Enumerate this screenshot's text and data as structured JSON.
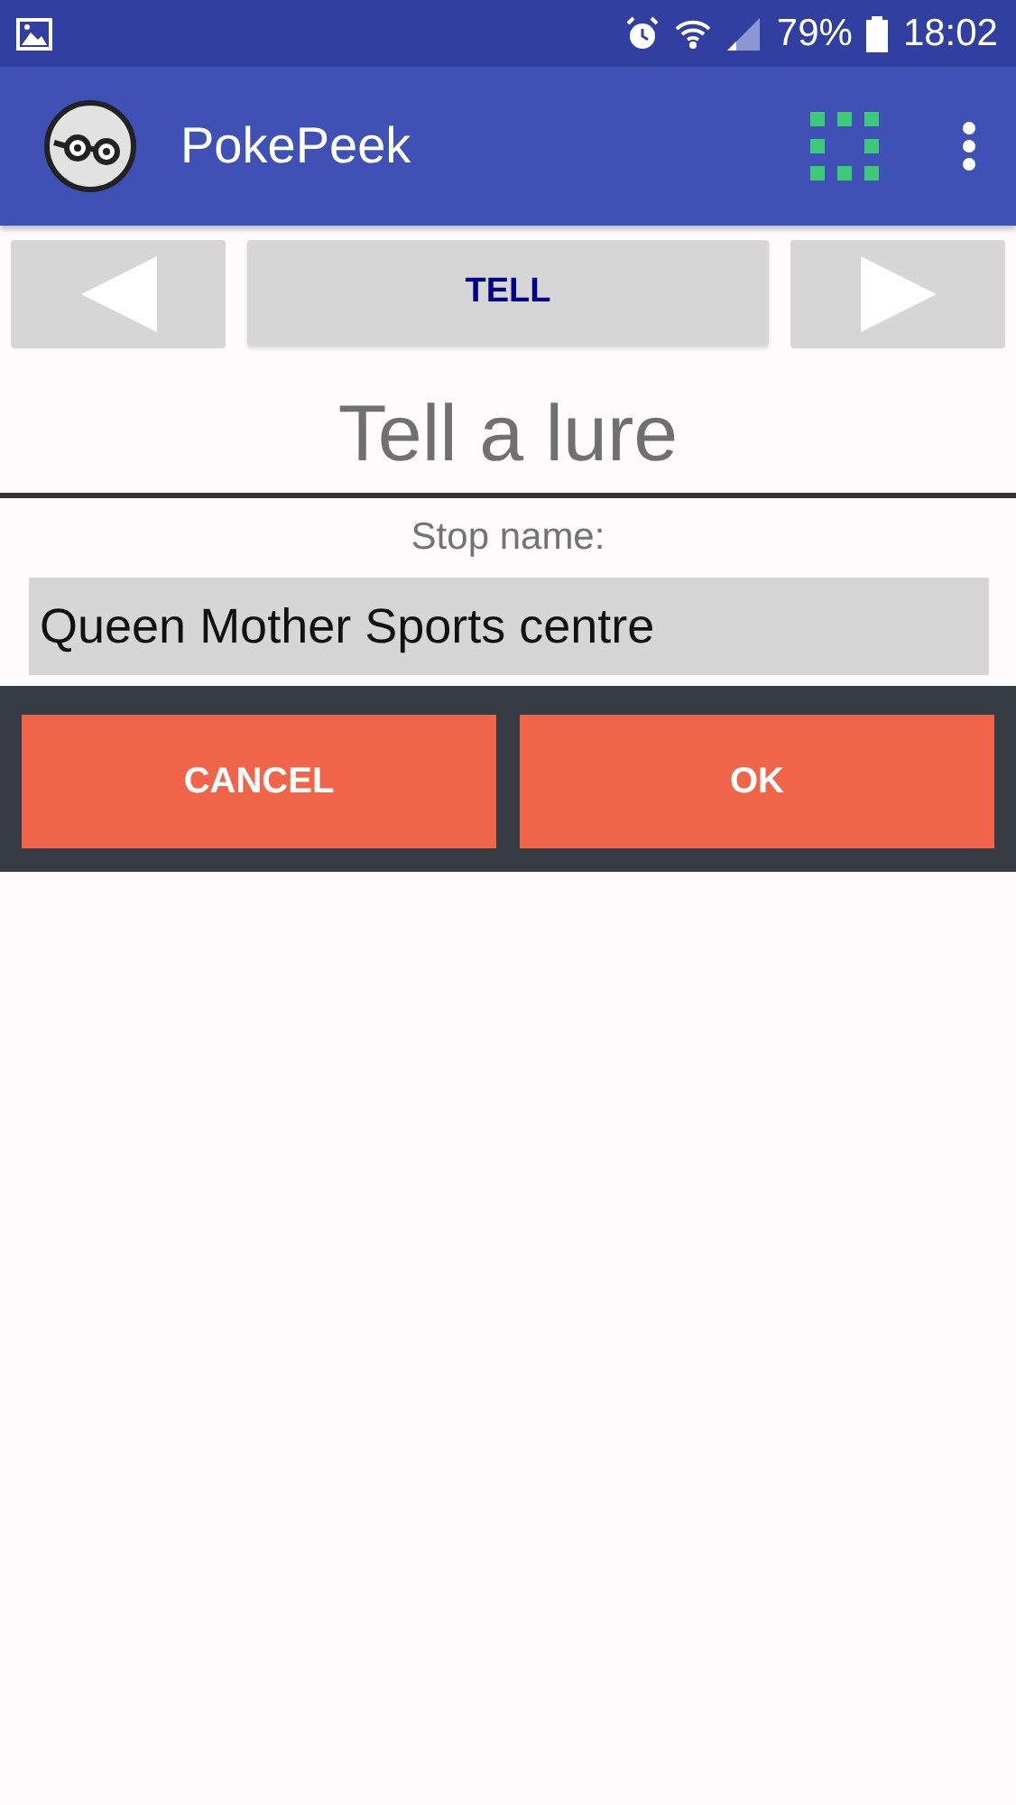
{
  "status_bar": {
    "battery": "79%",
    "time": "18:02"
  },
  "app_bar": {
    "title": "PokePeek"
  },
  "nav": {
    "center_label": "TELL"
  },
  "title": "Tell a lure",
  "field": {
    "label": "Stop name:",
    "value": "Queen Mother Sports centre"
  },
  "buttons": [
    {
      "label": "CANCEL"
    },
    {
      "label": "OK"
    }
  ]
}
